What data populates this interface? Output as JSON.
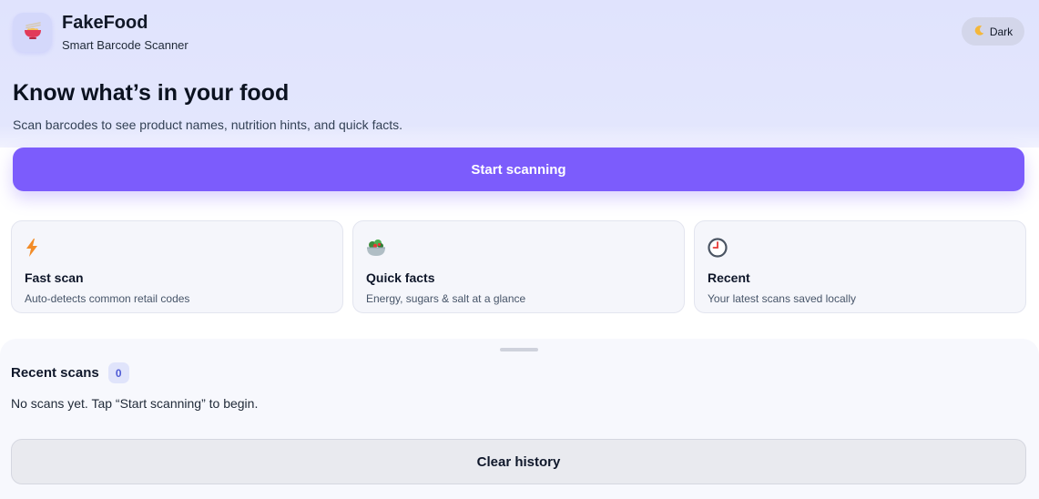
{
  "app": {
    "name": "FakeFood",
    "subtitle": "Smart Barcode Scanner",
    "logo_icon": "noodle-bowl-icon"
  },
  "theme_toggle": {
    "label": "Dark",
    "icon": "crescent-moon-icon"
  },
  "hero": {
    "headline": "Know what’s in your food",
    "tagline": "Scan barcodes to see product names, nutrition hints, and quick facts.",
    "cta_label": "Start scanning"
  },
  "features": [
    {
      "icon": "lightning-icon",
      "title": "Fast scan",
      "desc": "Auto-detects common retail codes"
    },
    {
      "icon": "salad-bowl-icon",
      "title": "Quick facts",
      "desc": "Energy, sugars & salt at a glance"
    },
    {
      "icon": "clock-icon",
      "title": "Recent",
      "desc": "Your latest scans saved locally"
    }
  ],
  "recent": {
    "title": "Recent scans",
    "count": "0",
    "empty_text": "No scans yet. Tap “Start scanning” to begin.",
    "clear_label": "Clear history"
  },
  "colors": {
    "accent": "#7c5cfc",
    "hero_bg": "#e0e3fd",
    "badge_text": "#4f5bd5"
  }
}
